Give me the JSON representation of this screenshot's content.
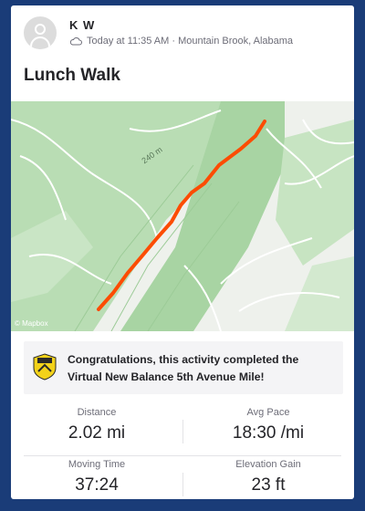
{
  "athlete": {
    "name": "K W",
    "avatar_icon": "user-icon"
  },
  "meta": {
    "icon": "cloud-icon",
    "text": "Today at 11:35 AM · Mountain Brook, Alabama"
  },
  "activity": {
    "title": "Lunch Walk"
  },
  "map": {
    "elevation_label": "240 m",
    "route_color": "#fc4c02",
    "watermark": "© Mapbox"
  },
  "achievement": {
    "badge_icon": "challenge-badge-icon",
    "line1": "Congratulations, this activity completed the",
    "line2": "Virtual New Balance 5th Avenue Mile!"
  },
  "stats": [
    {
      "label": "Distance",
      "value": "2.02 mi"
    },
    {
      "label": "Avg Pace",
      "value": "18:30 /mi"
    },
    {
      "label": "Moving Time",
      "value": "37:24"
    },
    {
      "label": "Elevation Gain",
      "value": "23 ft"
    }
  ],
  "colors": {
    "frame": "#1a3c78",
    "map_green": "#b9ddb4",
    "map_light": "#eef1ec"
  }
}
